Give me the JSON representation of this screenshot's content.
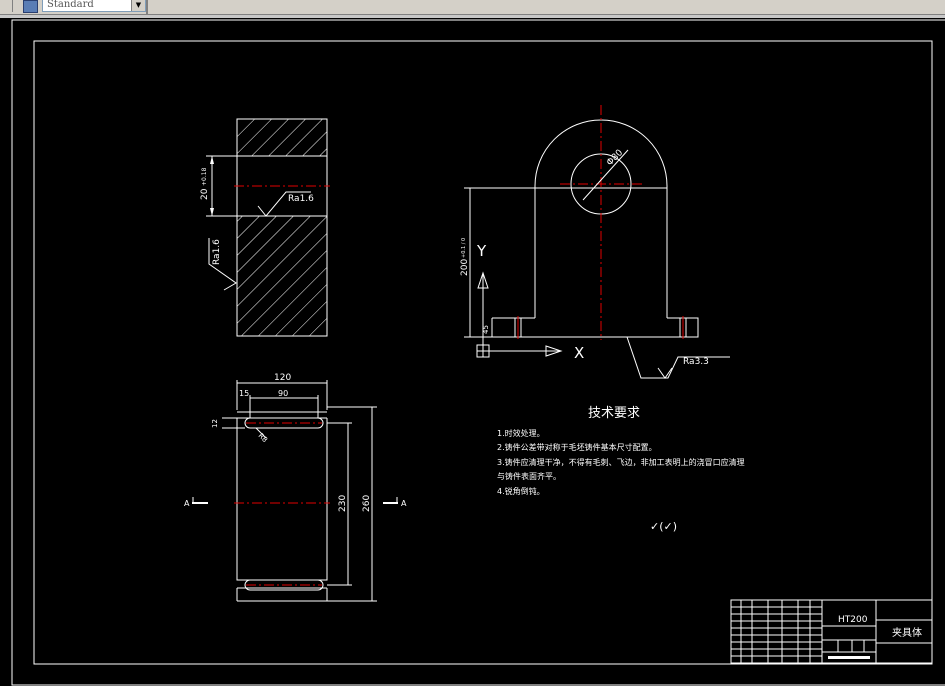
{
  "app": {
    "text_style_value": "Standard",
    "icons": [
      "text-style-icon",
      "chevron-down-icon"
    ]
  },
  "drawing": {
    "top_view": {
      "dim_height": "20",
      "dim_tol": "+0.18",
      "rough_1": "Ra1.6",
      "rough_2": "Ra1.6"
    },
    "bottom_view": {
      "dim_width": "120",
      "dim_15": "15",
      "dim_90": "90",
      "dim_r": "R8",
      "dim_left": "12",
      "dim_230": "230",
      "dim_260": "260",
      "section_left": "A",
      "section_right": "A"
    },
    "front_view": {
      "dim_diameter": "Φ80",
      "dim_height": "200",
      "dim_height_tol": "+0.1 / 0",
      "dim_45": "45",
      "rough": "Ra3.3",
      "axis_y": "Y",
      "axis_x": "X"
    },
    "tech_req": {
      "title": "技术要求",
      "lines": [
        "1.时效处理。",
        "2.铸件公差带对称于毛坯铸件基本尺寸配置。",
        "3.铸件应清理干净，不得有毛刺、飞边，非加工表明上的浇冒口应清理",
        "与铸件表面齐平。",
        "4.锐角倒钝。"
      ],
      "roughness_mark": "✓(✓)"
    },
    "title_block": {
      "material": "HT200",
      "part_name": "夹具体"
    }
  }
}
